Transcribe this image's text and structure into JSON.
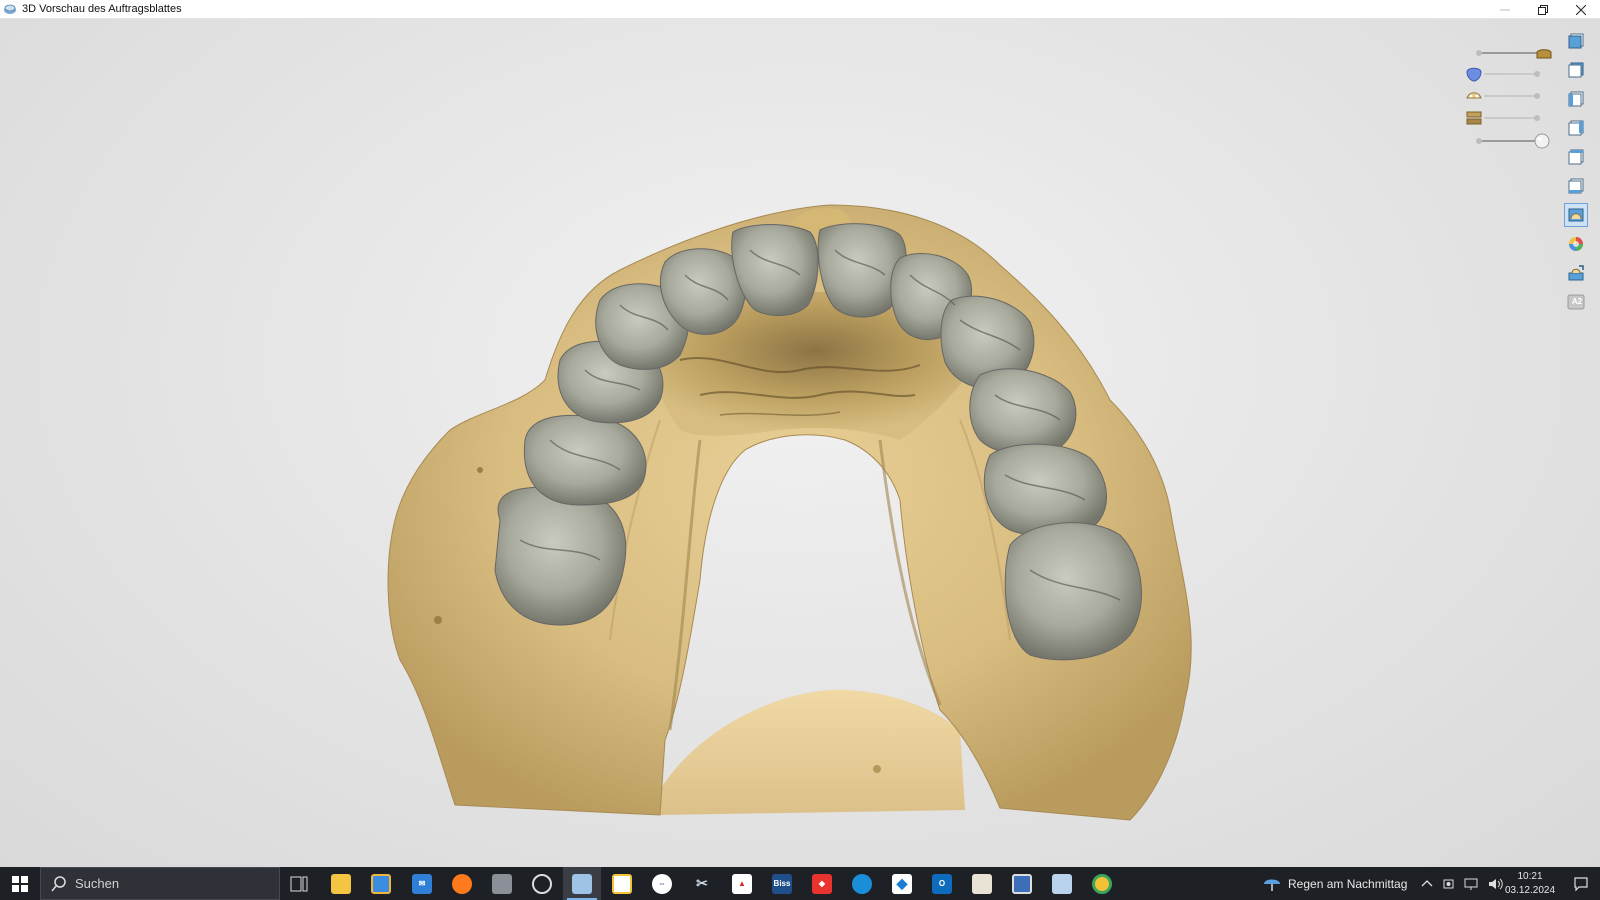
{
  "window": {
    "title": "3D Vorschau des Auftragsblattes",
    "icon": "app-3d-icon",
    "buttons": [
      "minimize-icon",
      "restore-icon",
      "close-icon"
    ]
  },
  "viewport": {
    "model": "maxillary-dental-model-with-crowns",
    "colors": {
      "gypsum": "#d9bf85",
      "crowns": "#a6a89b",
      "background": "#e6e6e6"
    }
  },
  "sliders": [
    {
      "icon": "model-base-icon",
      "value": 1.0
    },
    {
      "icon": "gingiva-icon",
      "value": 0.0
    },
    {
      "icon": "upper-jaw-icon",
      "value": 0.0
    },
    {
      "icon": "articulator-icon",
      "value": 0.0
    },
    {
      "icon": "sphere-icon",
      "value": 1.0
    }
  ],
  "toolbar": {
    "buttons": [
      {
        "icon": "view-front-icon",
        "active": false
      },
      {
        "icon": "view-back-icon",
        "active": false
      },
      {
        "icon": "view-left-icon",
        "active": false
      },
      {
        "icon": "view-right-icon",
        "active": false
      },
      {
        "icon": "view-top-icon",
        "active": false
      },
      {
        "icon": "view-bottom-icon",
        "active": false
      },
      {
        "icon": "view-occlusal-icon",
        "active": true
      },
      {
        "icon": "color-sphere-icon",
        "active": false
      },
      {
        "icon": "export-icon",
        "active": false
      },
      {
        "icon": "a2-shade-icon",
        "active": false,
        "label": "A2"
      }
    ]
  },
  "taskbar": {
    "search_placeholder": "Suchen",
    "apps": [
      {
        "icon": "task-view-icon",
        "active": false
      },
      {
        "icon": "file-explorer-icon",
        "active": false
      },
      {
        "icon": "store-icon",
        "active": false
      },
      {
        "icon": "mail-icon",
        "active": false
      },
      {
        "icon": "firefox-icon",
        "active": false
      },
      {
        "icon": "camera-app-icon",
        "active": false
      },
      {
        "icon": "circle-app-icon",
        "active": false
      },
      {
        "icon": "dental-viewer-icon",
        "active": true
      },
      {
        "icon": "chrome-like-icon",
        "active": false
      },
      {
        "icon": "teamviewer-icon",
        "active": false
      },
      {
        "icon": "scissors-app-icon",
        "active": false
      },
      {
        "icon": "pdf-app-icon",
        "active": false
      },
      {
        "icon": "biss-app-icon",
        "active": false,
        "label": "Biss"
      },
      {
        "icon": "anydesk-icon",
        "active": false
      },
      {
        "icon": "edge-icon",
        "active": false
      },
      {
        "icon": "diamond-app-icon",
        "active": false
      },
      {
        "icon": "outlook-icon",
        "active": false
      },
      {
        "icon": "dental-lab-icon",
        "active": false
      },
      {
        "icon": "remote-desktop-icon",
        "active": false
      },
      {
        "icon": "calculator-icon",
        "active": false
      },
      {
        "icon": "chrome-icon",
        "active": false
      }
    ],
    "weather": "Regen am Nachmittag",
    "time": "10:21",
    "date": "03.12.2024"
  }
}
